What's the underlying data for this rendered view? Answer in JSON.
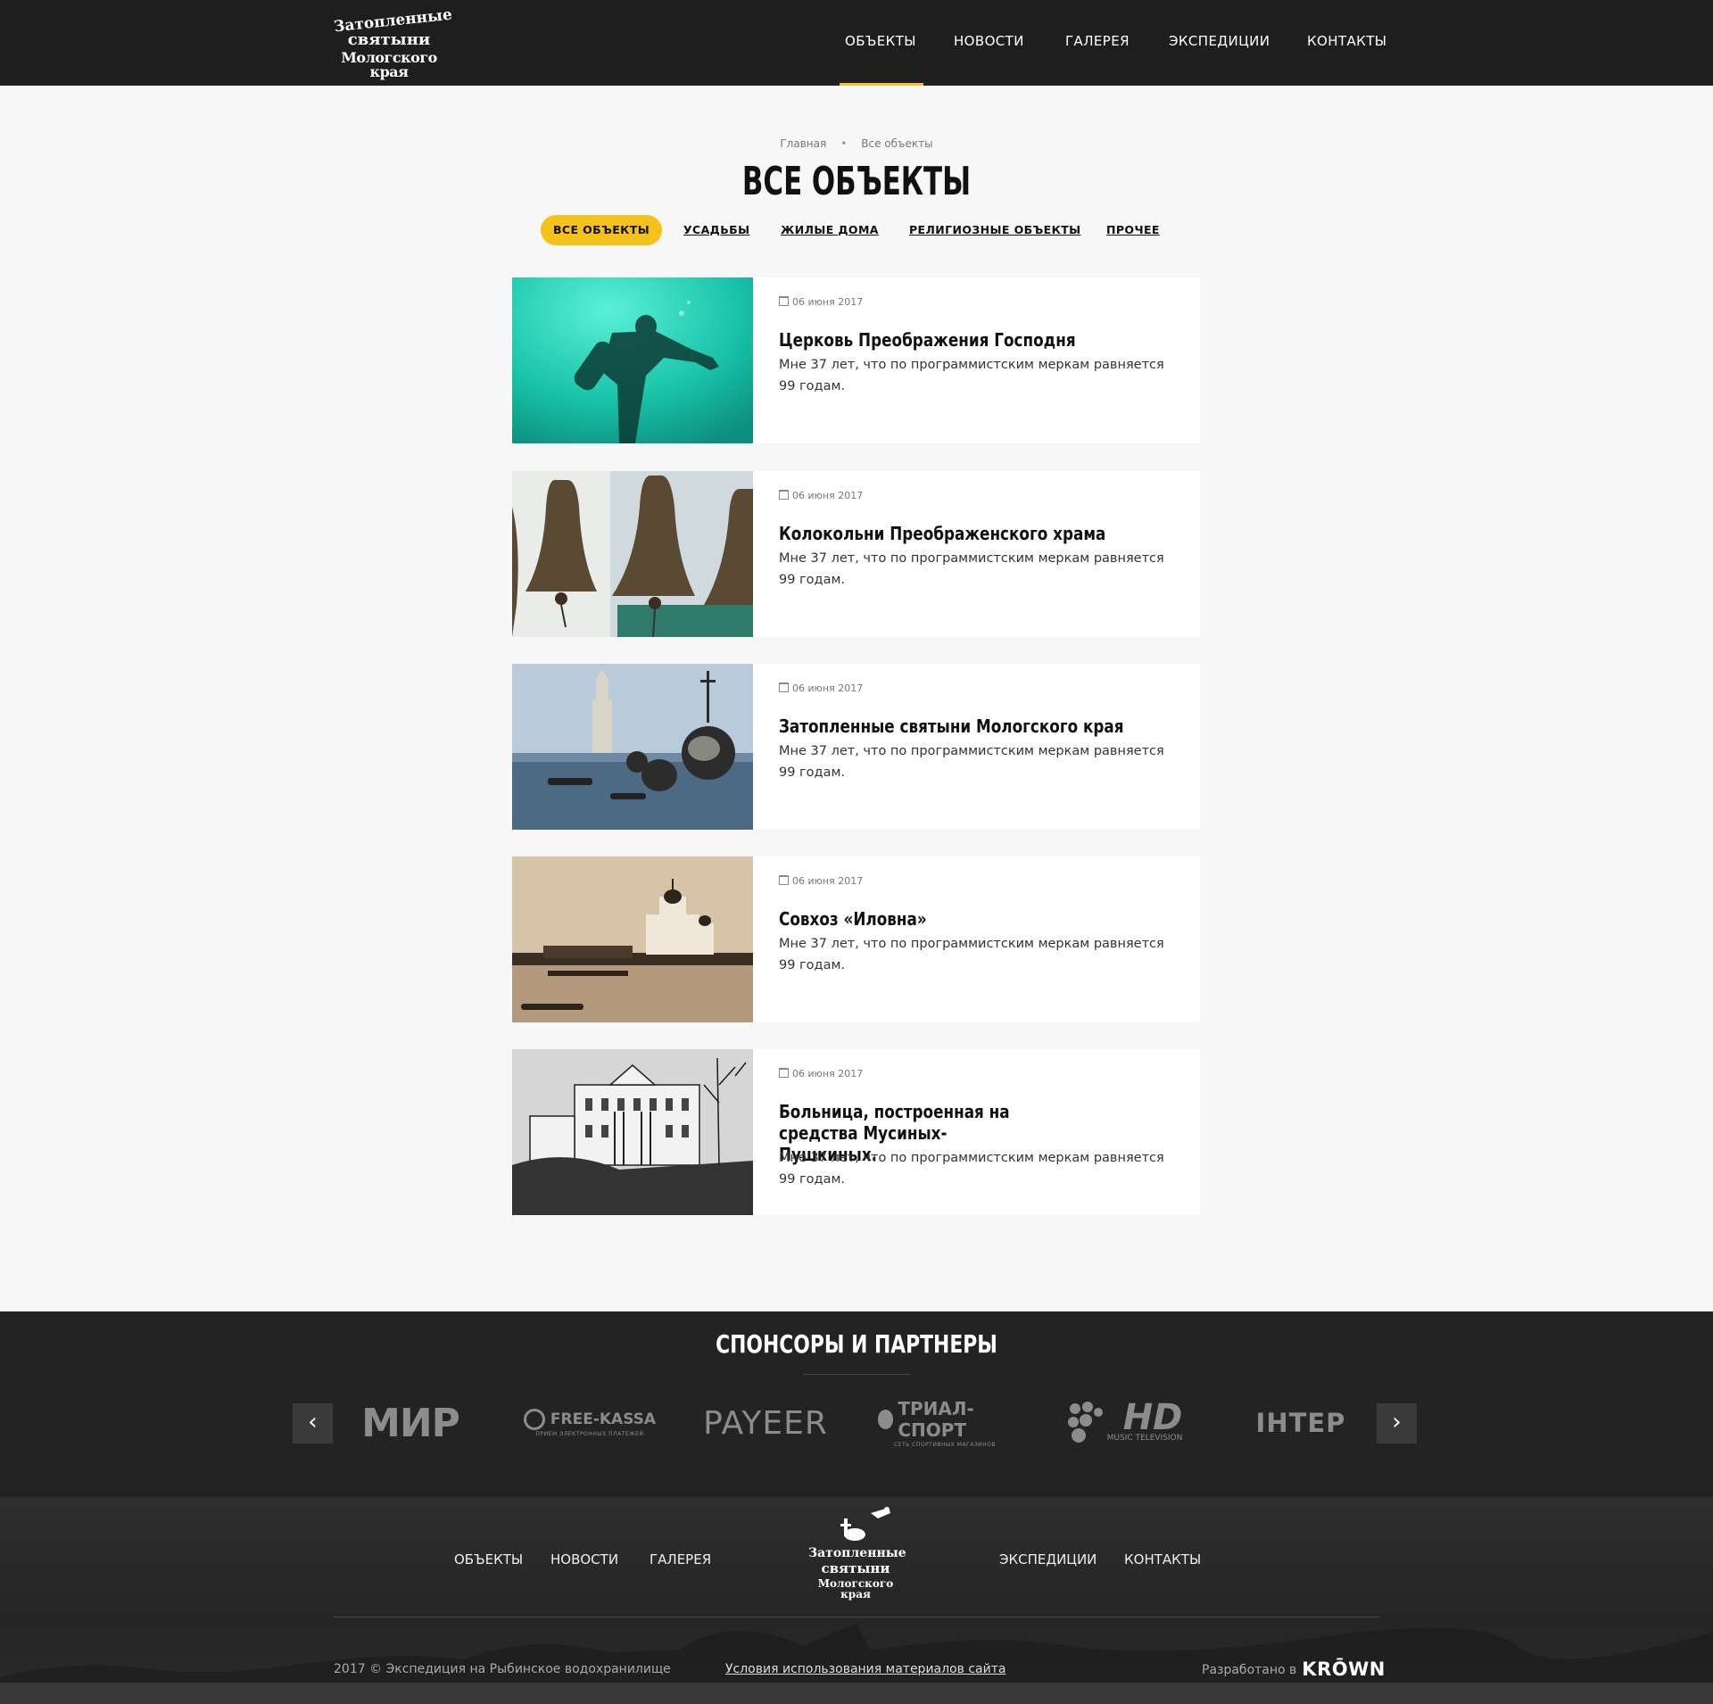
{
  "header": {
    "logo_lines": [
      "Затопленные",
      "святыни",
      "Мологского края"
    ],
    "nav": [
      "ОБЪЕКТЫ",
      "НОВОСТИ",
      "ГАЛЕРЕЯ",
      "ЭКСПЕДИЦИИ",
      "КОНТАКТЫ"
    ],
    "active_nav": "ОБЪЕКТЫ"
  },
  "breadcrumb": [
    "Главная",
    "Все объекты"
  ],
  "page_title": "ВСЕ ОБЪЕКТЫ",
  "filters": [
    "ВСЕ ОБЪЕКТЫ",
    "УСАДЬБЫ",
    "ЖИЛЫЕ ДОМА",
    "РЕЛИГИОЗНЫЕ ОБЪЕКТЫ",
    "ПРОЧЕЕ"
  ],
  "active_filter": "ВСЕ ОБЪЕКТЫ",
  "cards": [
    {
      "date": "06 июня 2017",
      "title": "Церковь Преображения Господня",
      "desc": "Мне 37 лет, что по программистским меркам равняется 99 годам.",
      "image": "diver-underwater-icon"
    },
    {
      "date": "06 июня 2017",
      "title": "Колокольни Преображенского храма",
      "desc": "Мне 37 лет, что по программистским меркам равняется 99 годам.",
      "image": "bells-icon"
    },
    {
      "date": "06 июня 2017",
      "title": "Затопленные святыни Мологского края",
      "desc": "Мне 37 лет, что по программистским меркам равняется 99 годам.",
      "image": "flooded-church-icon"
    },
    {
      "date": "06 июня 2017",
      "title": "Совхоз «Иловна»",
      "desc": "Мне 37 лет, что по программистским меркам равняется 99 годам.",
      "image": "sepia-church-icon"
    },
    {
      "date": "06 июня 2017",
      "title": "Больница, построенная на средства Мусиных-Пушкиных.",
      "desc": "Мне 37 лет, что по программистским меркам равняется 99 годам.",
      "image": "hospital-building-icon"
    }
  ],
  "sponsors": {
    "title": "СПОНСОРЫ И ПАРТНЕРЫ",
    "partners": [
      "МИР",
      "FREE-KASSA",
      "PAYEER",
      "ТРИАЛ-СПОРТ",
      "HD",
      "ІНТЕР"
    ],
    "partner_sublabels": {
      "free_kassa": "ПРИЕМ ЭЛЕКТРОННЫХ ПЛАТЕЖЕЙ",
      "trial": "СЕТЬ СПОРТИВНЫХ МАГАЗИНОВ",
      "hd": "MUSIC TELEVISION"
    }
  },
  "footer": {
    "nav_left": [
      "ОБЪЕКТЫ",
      "НОВОСТИ",
      "ГАЛЕРЕЯ"
    ],
    "nav_right": [
      "ЭКСПЕДИЦИИ",
      "КОНТАКТЫ"
    ],
    "logo_lines": [
      "Затопленные",
      "святыни",
      "Мологского края"
    ],
    "copyright": "2017 © Экспедиция на Рыбинское водохранилище",
    "terms": "Условия использования материалов сайта",
    "developed_by": "Разработано в",
    "developer": "KRŌWN"
  },
  "colors": {
    "accent": "#f5c21b",
    "header_bg": "#1e1e1e",
    "page_bg": "#f7f7f7",
    "sponsors_bg": "#232323"
  }
}
